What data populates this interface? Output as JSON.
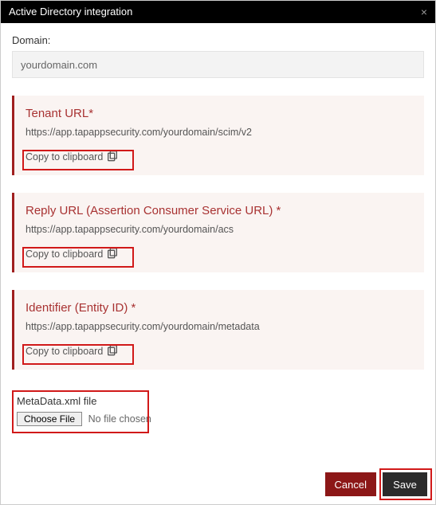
{
  "dialog": {
    "title": "Active Directory integration"
  },
  "domain": {
    "label": "Domain:",
    "value": "yourdomain.com"
  },
  "cards": {
    "tenant": {
      "title": "Tenant URL*",
      "url": "https://app.tapappsecurity.com/yourdomain/scim/v2",
      "copy_label": "Copy to clipboard"
    },
    "reply": {
      "title": "Reply URL (Assertion Consumer Service URL) *",
      "url": "https://app.tapappsecurity.com/yourdomain/acs",
      "copy_label": "Copy to clipboard"
    },
    "identifier": {
      "title": "Identifier (Entity ID) *",
      "url": "https://app.tapappsecurity.com/yourdomain/metadata",
      "copy_label": "Copy to clipboard"
    }
  },
  "metadata": {
    "label": "MetaData.xml file",
    "choose_label": "Choose File",
    "no_file": "No file chosen"
  },
  "footer": {
    "cancel": "Cancel",
    "save": "Save"
  }
}
